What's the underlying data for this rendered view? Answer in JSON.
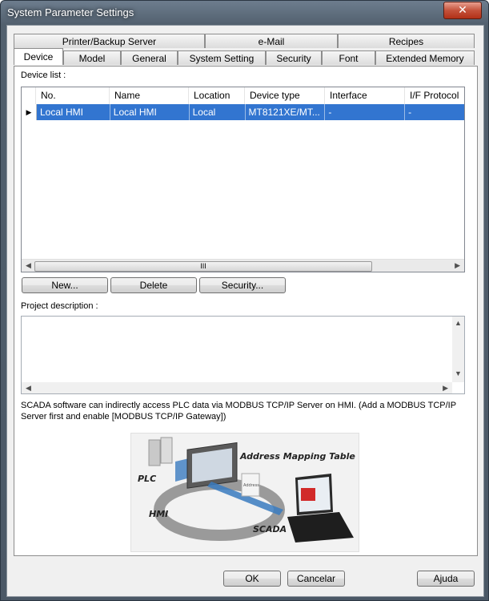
{
  "window": {
    "title": "System Parameter Settings",
    "close_glyph": "✕"
  },
  "tabs_row1": [
    "Printer/Backup Server",
    "e-Mail",
    "Recipes"
  ],
  "tabs_row2": [
    "Device",
    "Model",
    "General",
    "System Setting",
    "Security",
    "Font",
    "Extended Memory"
  ],
  "active_tab": "Device",
  "device_list": {
    "label": "Device list :",
    "columns": [
      "No.",
      "Name",
      "Location",
      "Device type",
      "Interface",
      "I/F Protocol"
    ],
    "rows": [
      {
        "marker": "▶",
        "cells": [
          "Local HMI",
          "Local HMI",
          "Local",
          "MT8121XE/MT...",
          "-",
          "-"
        ]
      }
    ],
    "scroll_thumb": "III"
  },
  "buttons": {
    "new": "New...",
    "delete": "Delete",
    "security": "Security..."
  },
  "project_description": {
    "label": "Project description :",
    "value": ""
  },
  "note": "SCADA software can indirectly access PLC data via MODBUS TCP/IP Server on HMI. (Add a MODBUS TCP/IP Server first and enable [MODBUS TCP/IP Gateway])",
  "illustration": {
    "address_mapping_label": "Address Mapping Table",
    "plc_label": "PLC",
    "hmi_label": "HMI",
    "scada_label": "SCADA",
    "screen_text": "Address"
  },
  "footer": {
    "ok": "OK",
    "cancel": "Cancelar",
    "help": "Ajuda"
  },
  "colors": {
    "selection": "#3275d0",
    "title_bg": "#52606e"
  }
}
